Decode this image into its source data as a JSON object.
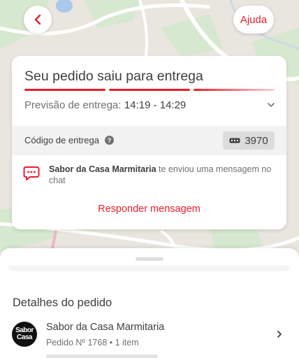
{
  "colors": {
    "accent": "#ea1d2c",
    "progress_active": "#ea1d2c",
    "progress_pending": "#f3b7bc"
  },
  "header": {
    "back_icon": "chevron-left-icon",
    "help_label": "Ajuda"
  },
  "status": {
    "title": "Seu pedido saiu para entrega",
    "progress_steps_done": 2,
    "progress_steps_total": 3,
    "eta_label": "Previsão de entrega:",
    "eta_value": "14:19 - 14:29",
    "delivery_code_label": "Código de entrega",
    "delivery_code": "3970",
    "message_sender": "Sabor da Casa Marmitaria",
    "message_text": "te enviou uma mensagem no chat",
    "reply_label": "Responder mensagem"
  },
  "details": {
    "title": "Detalhes do pedido",
    "store_name": "Sabor da Casa Marmitaria",
    "order_info": "Pedido Nº 1768 • 1 item",
    "logo_text_1": "Sabor",
    "logo_text_2": "Casa"
  }
}
